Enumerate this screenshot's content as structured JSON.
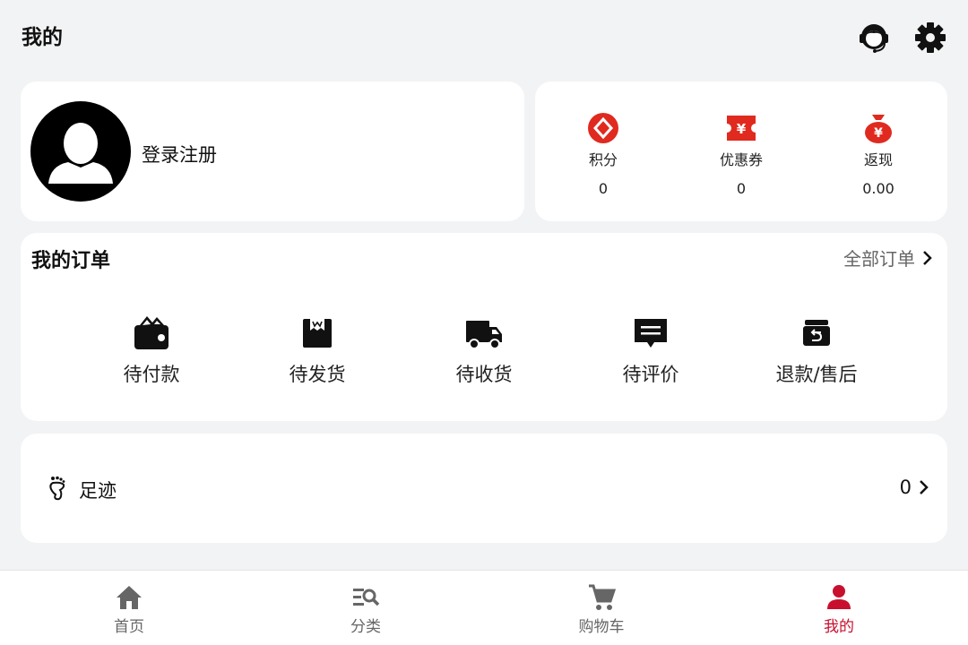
{
  "header": {
    "title": "我的",
    "icons": [
      "customer-service-icon",
      "settings-gear-icon"
    ]
  },
  "profile": {
    "login_text": "登录注册"
  },
  "assets": [
    {
      "label": "积分",
      "value": "0",
      "icon": "points-icon"
    },
    {
      "label": "优惠券",
      "value": "0",
      "icon": "coupon-icon"
    },
    {
      "label": "返现",
      "value": "0.00",
      "icon": "cashback-bag-icon"
    }
  ],
  "orders": {
    "title": "我的订单",
    "all_label": "全部订单",
    "items": [
      {
        "label": "待付款",
        "icon": "wallet-icon"
      },
      {
        "label": "待发货",
        "icon": "package-icon"
      },
      {
        "label": "待收货",
        "icon": "truck-icon"
      },
      {
        "label": "待评价",
        "icon": "comment-icon"
      },
      {
        "label": "退款/售后",
        "icon": "return-box-icon"
      }
    ]
  },
  "footprint": {
    "label": "足迹",
    "count": "0"
  },
  "tabbar": {
    "items": [
      {
        "label": "首页",
        "icon": "home-icon"
      },
      {
        "label": "分类",
        "icon": "category-search-icon"
      },
      {
        "label": "购物车",
        "icon": "cart-icon"
      },
      {
        "label": "我的",
        "icon": "user-icon",
        "active": true
      }
    ]
  },
  "colors": {
    "accent": "#c8102e",
    "icon_red": "#e02a1f",
    "background": "#f2f3f5"
  }
}
